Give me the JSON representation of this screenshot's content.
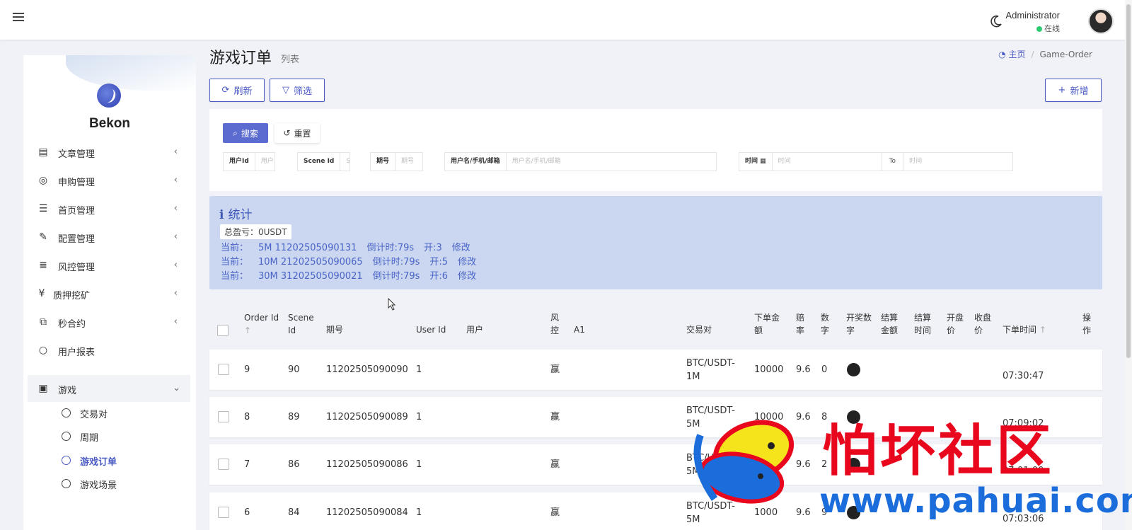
{
  "topbar": {
    "admin_name": "Administrator",
    "status": "在线"
  },
  "sidebar": {
    "brand": "Bekon",
    "items": [
      {
        "label": "文章管理",
        "icon": "newspaper-icon"
      },
      {
        "label": "申购管理",
        "icon": "lifebuoy-icon"
      },
      {
        "label": "首页管理",
        "icon": "list-icon"
      },
      {
        "label": "配置管理",
        "icon": "wrench-icon"
      },
      {
        "label": "风控管理",
        "icon": "indent-icon"
      },
      {
        "label": "质押挖矿",
        "icon": "yen-icon"
      },
      {
        "label": "秒合约",
        "icon": "copy-icon"
      },
      {
        "label": "用户报表",
        "icon": "circle-icon"
      },
      {
        "label": "游戏",
        "icon": "contact-icon"
      }
    ],
    "sub_items": [
      {
        "label": "交易对"
      },
      {
        "label": "周期"
      },
      {
        "label": "游戏订单"
      },
      {
        "label": "游戏场景"
      }
    ]
  },
  "header": {
    "title": "游戏订单",
    "subtitle": "列表",
    "breadcrumb_home": "主页",
    "breadcrumb_current": "Game-Order"
  },
  "toolbar": {
    "refresh": "刷新",
    "filter": "筛选",
    "add": "新增"
  },
  "filter": {
    "search": "搜索",
    "reset": "重置",
    "user_id_label": "用户Id",
    "user_id_placeholder": "用户",
    "scene_id_label": "Scene Id",
    "scene_id_placeholder": "S",
    "period_label": "期号",
    "period_placeholder": "期号",
    "user_label": "用户名/手机/邮箱",
    "user_placeholder": "用户名/手机/邮箱",
    "time_label": "时间",
    "time_placeholder_from": "时间",
    "to": "To",
    "time_placeholder_to": "时间"
  },
  "stats": {
    "title": "统计",
    "total": "总盈亏：0USDT",
    "lines": [
      {
        "prefix": "当前：",
        "period": "5M 11202505090131",
        "countdown": "倒计时:79s",
        "open": "开:3",
        "edit": "修改"
      },
      {
        "prefix": "当前：",
        "period": "10M 21202505090065",
        "countdown": "倒计时:79s",
        "open": "开:5",
        "edit": "修改"
      },
      {
        "prefix": "当前：",
        "period": "30M 31202505090021",
        "countdown": "倒计时:79s",
        "open": "开:6",
        "edit": "修改"
      }
    ]
  },
  "table": {
    "headers": {
      "order_id": "Order Id",
      "scene_id": "Scene Id",
      "period": "期号",
      "user_id": "User Id",
      "user": "用户",
      "risk": "风控",
      "a1": "A1",
      "pair": "交易对",
      "amount": "下单金额",
      "odds": "赔率",
      "number": "数字",
      "draw_number": "开奖数字",
      "settle_amount": "结算金额",
      "settle_time": "结算时间",
      "open_price": "开盘价",
      "close_price": "收盘价",
      "order_time": "下单时间",
      "action": "操作"
    },
    "rows": [
      {
        "order_id": "9",
        "scene_id": "90",
        "period": "11202505090090",
        "user_id": "1",
        "risk": "赢",
        "pair": "BTC/USDT-1M",
        "amount": "10000",
        "odds": "9.6",
        "number": "0",
        "order_time": "07:30:47"
      },
      {
        "order_id": "8",
        "scene_id": "89",
        "period": "11202505090089",
        "user_id": "1",
        "risk": "赢",
        "pair": "BTC/USDT-5M",
        "amount": "10000",
        "odds": "9.6",
        "number": "8",
        "order_time": "07:09:02"
      },
      {
        "order_id": "7",
        "scene_id": "86",
        "period": "11202505090086",
        "user_id": "1",
        "risk": "赢",
        "pair": "BTC/USDT-5M",
        "amount": "10000",
        "odds": "9.6",
        "number": "2",
        "order_time": "07:01:00"
      },
      {
        "order_id": "6",
        "scene_id": "84",
        "period": "11202505090084",
        "user_id": "1",
        "risk": "赢",
        "pair": "BTC/USDT-5M",
        "amount": "1000",
        "odds": "9.6",
        "number": "9",
        "order_time": "07:03:06"
      }
    ]
  },
  "watermark": {
    "cn": "怕坏社区",
    "url": "www.pahuai.com"
  },
  "colors": {
    "accent": "#4a5bc4",
    "stats_bg": "#cbd7f1",
    "watermark_red": "#e8071c",
    "watermark_blue": "#1b6ddc"
  }
}
